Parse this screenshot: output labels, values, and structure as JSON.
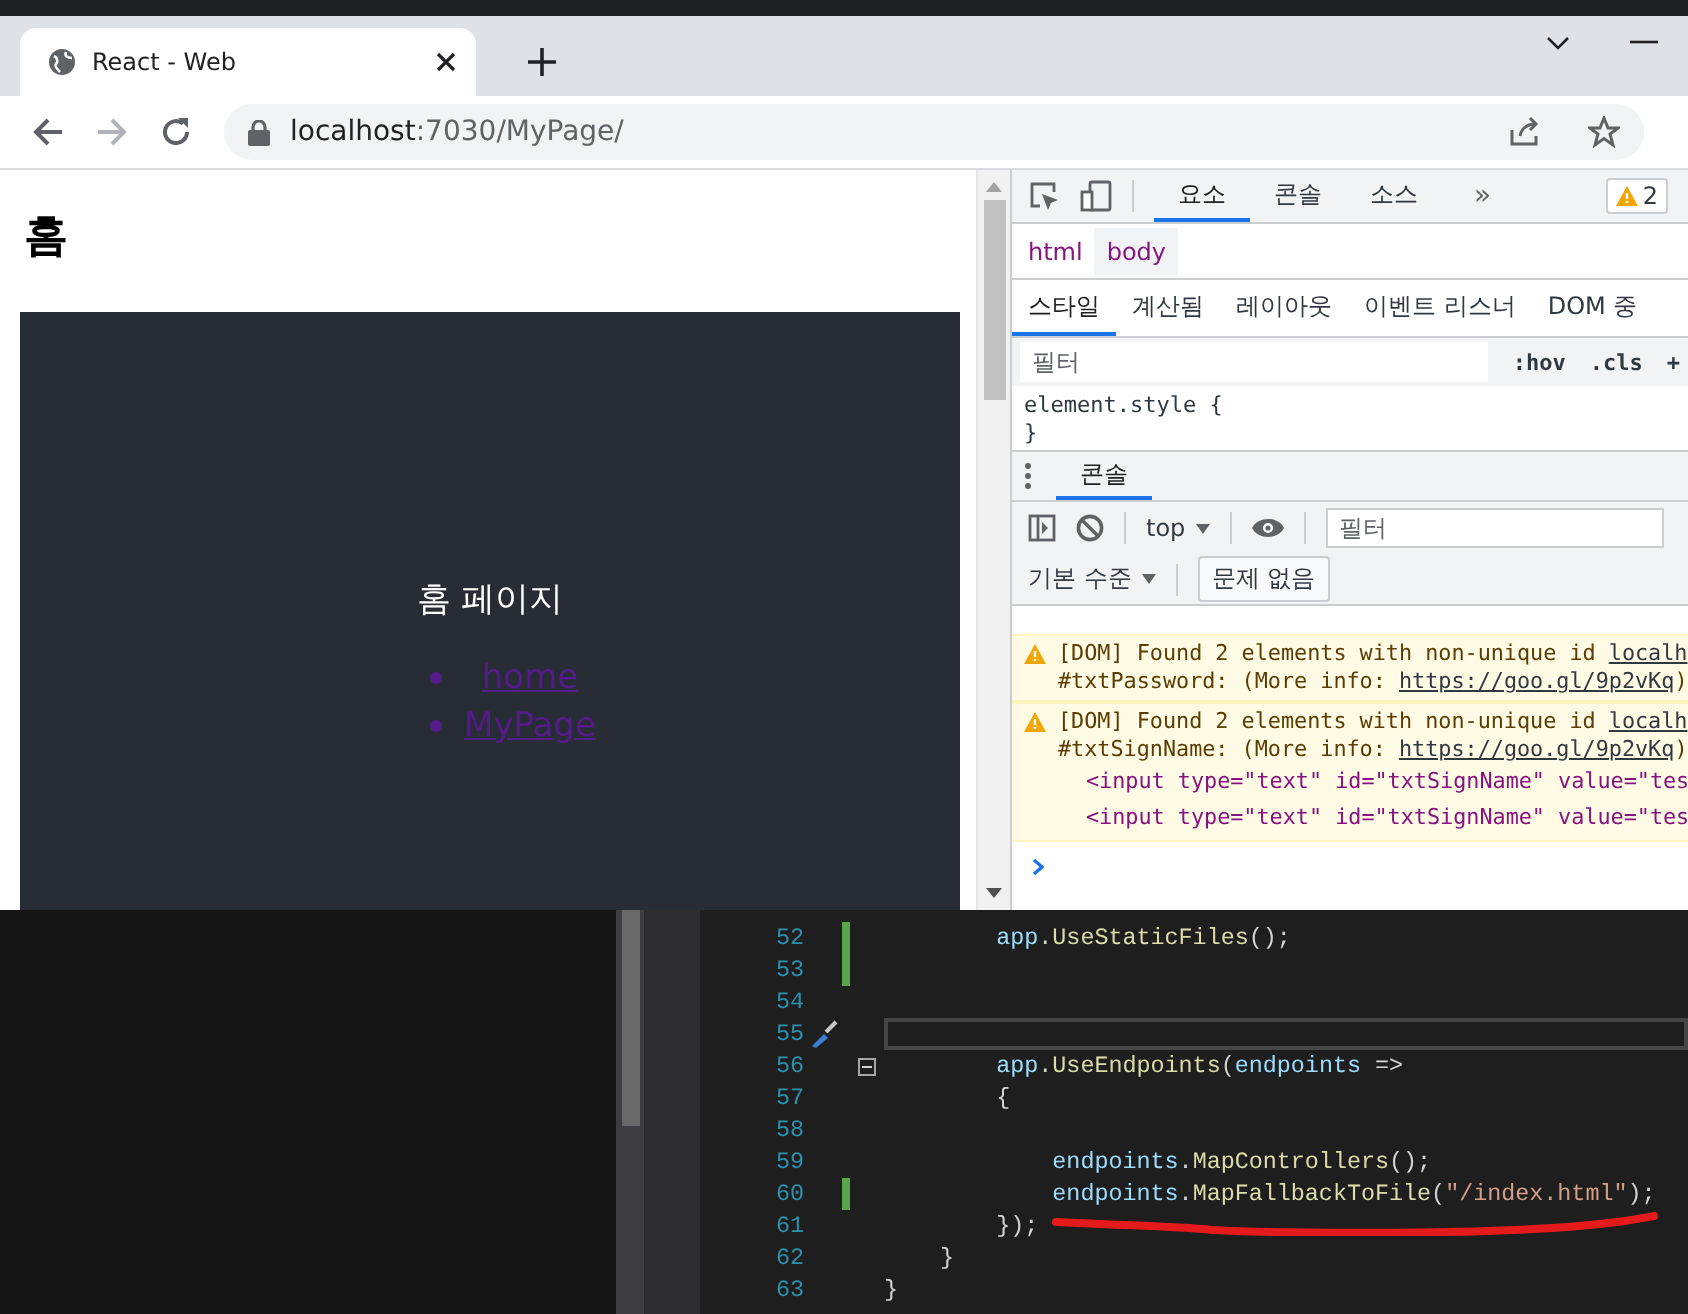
{
  "browser": {
    "tab": {
      "title": "React - Web"
    },
    "navigation": {
      "back_disabled": false,
      "forward_disabled": true
    },
    "address": {
      "host": "localhost",
      "path": ":7030/MyPage/"
    },
    "page": {
      "heading": "홈",
      "app_title": "홈 페이지",
      "links": [
        {
          "label": "home"
        },
        {
          "label": "MyPage"
        }
      ]
    }
  },
  "devtools": {
    "tabs": [
      {
        "label": "요소",
        "selected": true
      },
      {
        "label": "콘솔",
        "selected": false
      },
      {
        "label": "소스",
        "selected": false
      }
    ],
    "more": "»",
    "issues_badge": "2",
    "breadcrumbs": [
      {
        "label": "html",
        "selected": false
      },
      {
        "label": "body",
        "selected": true
      }
    ],
    "style_tabs": [
      {
        "label": "스타일",
        "selected": true
      },
      {
        "label": "계산됨",
        "selected": false
      },
      {
        "label": "레이아웃",
        "selected": false
      },
      {
        "label": "이벤트 리스너",
        "selected": false
      },
      {
        "label": "DOM 중",
        "selected": false
      }
    ],
    "styles_filter": {
      "placeholder": "필터"
    },
    "style_buttons": [
      ":hov",
      ".cls",
      "+"
    ],
    "rule_lines": [
      "element.style {",
      "}"
    ],
    "drawer_tabs": [
      {
        "label": "콘솔",
        "selected": true
      }
    ],
    "console": {
      "context": "top",
      "filter": {
        "placeholder": "필터"
      },
      "levels": "기본 수준",
      "issues": "문제 없음",
      "messages": [
        {
          "kind": "warning",
          "text": "[DOM] Found 2 elements with non-unique id ",
          "source": "localh",
          "detail": "#txtPassword: (More info: ",
          "url": "https://goo.gl/9p2vKq",
          "end": ")"
        },
        {
          "kind": "warning",
          "text": "[DOM] Found 2 elements with non-unique id ",
          "source": "localh",
          "detail": "#txtSignName: (More info: ",
          "url": "https://goo.gl/9p2vKq",
          "end": ")",
          "elements": [
            "<input type=\"text\" id=\"txtSignName\" value=\"tes",
            "<input type=\"text\" id=\"txtSignName\" value=\"tes"
          ]
        }
      ]
    }
  },
  "editor": {
    "lines": [
      {
        "number": "52",
        "changed": true,
        "current": false,
        "foldable": false,
        "quick_action": false,
        "tokens": [
          {
            "kind": "ident",
            "text": "        app"
          },
          {
            "kind": "punct",
            "text": "."
          },
          {
            "kind": "method",
            "text": "UseStaticFiles"
          },
          {
            "kind": "punct",
            "text": "();"
          }
        ]
      },
      {
        "number": "53",
        "changed": true,
        "current": false,
        "foldable": false,
        "quick_action": false
      },
      {
        "number": "54",
        "changed": false,
        "current": false,
        "foldable": false,
        "quick_action": false
      },
      {
        "number": "55",
        "changed": false,
        "current": true,
        "foldable": false,
        "quick_action": true
      },
      {
        "number": "56",
        "changed": false,
        "current": false,
        "foldable": true,
        "quick_action": false,
        "tokens": [
          {
            "kind": "ident",
            "text": "        app"
          },
          {
            "kind": "punct",
            "text": "."
          },
          {
            "kind": "method",
            "text": "UseEndpoints"
          },
          {
            "kind": "punct",
            "text": "("
          },
          {
            "kind": "ident",
            "text": "endpoints"
          },
          {
            "kind": "punct",
            "text": " =>"
          }
        ]
      },
      {
        "number": "57",
        "changed": false,
        "current": false,
        "foldable": false,
        "quick_action": false,
        "tokens": [
          {
            "kind": "punct",
            "text": "        {"
          }
        ]
      },
      {
        "number": "58",
        "changed": false,
        "current": false,
        "foldable": false,
        "quick_action": false
      },
      {
        "number": "59",
        "changed": false,
        "current": false,
        "foldable": false,
        "quick_action": false,
        "tokens": [
          {
            "kind": "ident",
            "text": "            endpoints"
          },
          {
            "kind": "punct",
            "text": "."
          },
          {
            "kind": "method",
            "text": "MapControllers"
          },
          {
            "kind": "punct",
            "text": "();"
          }
        ]
      },
      {
        "number": "60",
        "changed": true,
        "current": false,
        "foldable": false,
        "quick_action": false,
        "tokens": [
          {
            "kind": "ident",
            "text": "            endpoints"
          },
          {
            "kind": "punct",
            "text": "."
          },
          {
            "kind": "method",
            "text": "MapFallbackToFile"
          },
          {
            "kind": "punct",
            "text": "("
          },
          {
            "kind": "string",
            "text": "\"/index.html\""
          },
          {
            "kind": "punct",
            "text": ");"
          }
        ]
      },
      {
        "number": "61",
        "changed": false,
        "current": false,
        "foldable": false,
        "quick_action": false,
        "tokens": [
          {
            "kind": "punct",
            "text": "        });"
          }
        ]
      },
      {
        "number": "62",
        "changed": false,
        "current": false,
        "foldable": false,
        "quick_action": false,
        "tokens": [
          {
            "kind": "punct",
            "text": "    }"
          }
        ]
      },
      {
        "number": "63",
        "changed": false,
        "current": false,
        "foldable": false,
        "quick_action": false,
        "tokens": [
          {
            "kind": "punct",
            "text": "}"
          }
        ]
      }
    ]
  }
}
